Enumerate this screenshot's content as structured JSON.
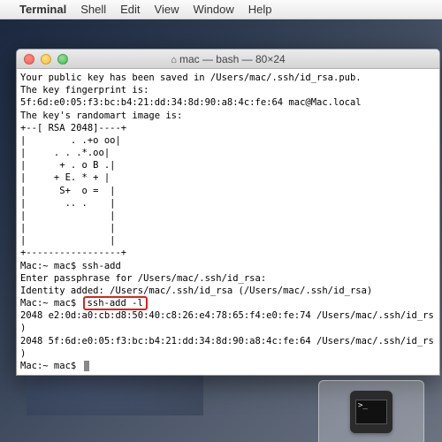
{
  "menubar": {
    "app": "Terminal",
    "items": [
      "Shell",
      "Edit",
      "View",
      "Window",
      "Help"
    ]
  },
  "window": {
    "title": "mac — bash — 80×24",
    "home_icon": "⌂"
  },
  "terminal": {
    "lines": [
      "Your public key has been saved in /Users/mac/.ssh/id_rsa.pub.",
      "The key fingerprint is:",
      "5f:6d:e0:05:f3:bc:b4:21:dd:34:8d:90:a8:4c:fe:64 mac@Mac.local",
      "The key's randomart image is:",
      "+--[ RSA 2048]----+",
      "|        . .+o oo|",
      "|     . . .*.oo|",
      "|      + . o B .|",
      "|     + E. * + |",
      "|      S+  o =  |",
      "|       .. .    |",
      "|               |",
      "|               |",
      "|               |",
      "+-----------------+",
      "Mac:~ mac$ ssh-add",
      "Enter passphrase for /Users/mac/.ssh/id_rsa:",
      "Identity added: /Users/mac/.ssh/id_rsa (/Users/mac/.ssh/id_rsa)"
    ],
    "hl_prefix": "Mac:~ mac$ ",
    "hl_cmd": "ssh-add -l",
    "tail": [
      "2048 e2:0d:a0:cb:d8:50:40:c8:26:e4:78:65:f4:e0:fe:74 /Users/mac/.ssh/id_rs",
      ")",
      "2048 5f:6d:e0:05:f3:bc:b4:21:dd:34:8d:90:a8:4c:fe:64 /Users/mac/.ssh/id_rs",
      ")",
      "Mac:~ mac$ "
    ]
  },
  "dock": {
    "icon_name": "terminal-icon",
    "prompt": ">_"
  }
}
